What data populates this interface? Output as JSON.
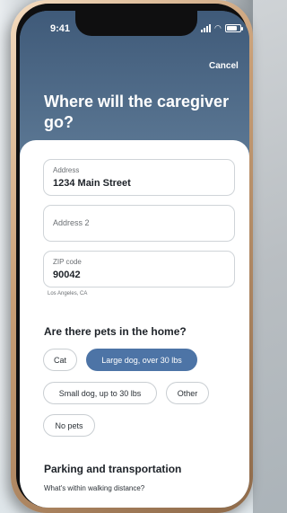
{
  "status_bar": {
    "time": "9:41"
  },
  "header": {
    "cancel_label": "Cancel",
    "title": "Where will the caregiver go?"
  },
  "form": {
    "address": {
      "label": "Address",
      "value": "1234 Main Street"
    },
    "address2": {
      "placeholder": "Address 2"
    },
    "zip": {
      "label": "ZIP code",
      "value": "90042",
      "hint": "Los Angeles, CA"
    }
  },
  "pets": {
    "question": "Are there pets in the home?",
    "options": [
      {
        "label": "Cat",
        "selected": false
      },
      {
        "label": "Large dog, over 30 lbs",
        "selected": true
      },
      {
        "label": "Small dog, up to 30 lbs",
        "selected": false
      },
      {
        "label": "Other",
        "selected": false
      },
      {
        "label": "No pets",
        "selected": false
      }
    ]
  },
  "parking": {
    "title": "Parking and transportation",
    "subtitle": "What's within walking distance?"
  },
  "colors": {
    "header_bg": "#4f6c89",
    "accent_selected": "#4d74a6",
    "text_dark": "#1d2228"
  }
}
